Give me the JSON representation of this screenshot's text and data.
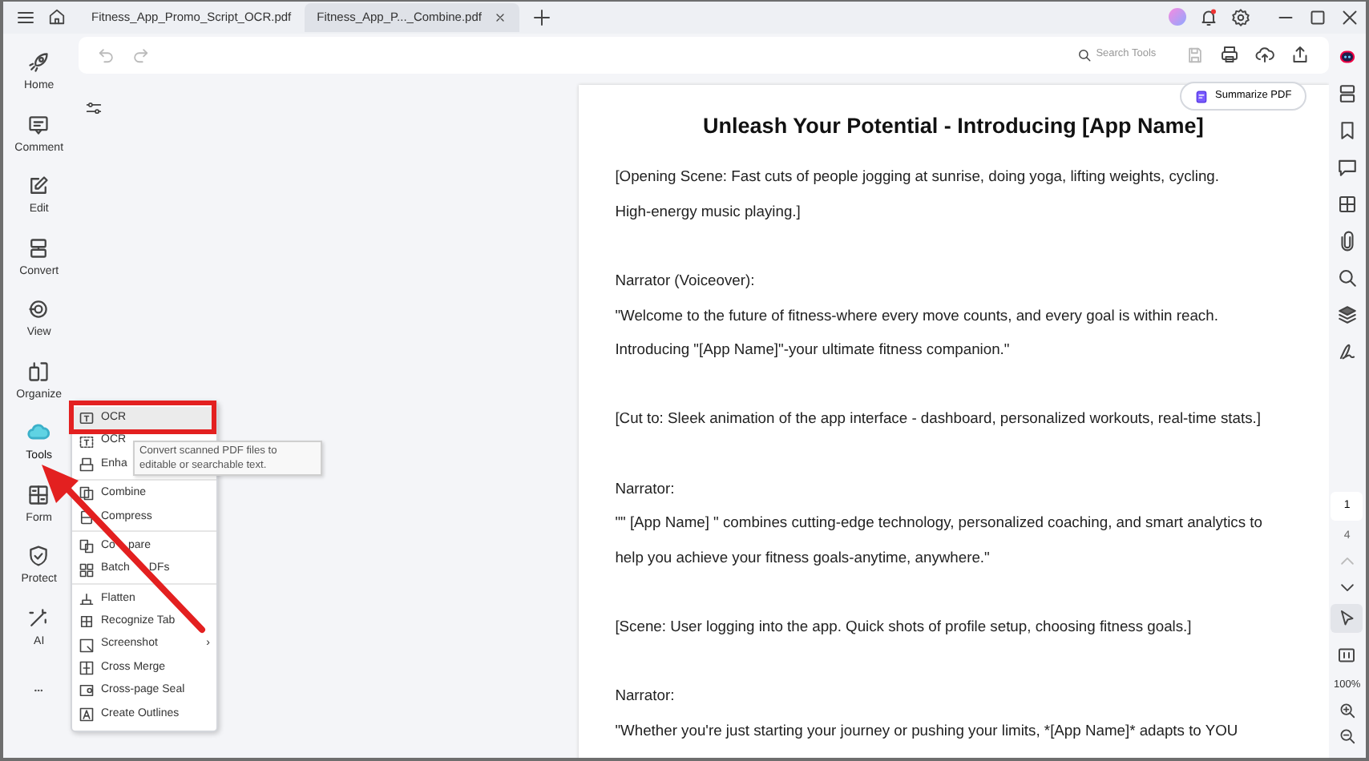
{
  "tabs": [
    {
      "label": "Fitness_App_Promo_Script_OCR.pdf",
      "selected": false,
      "closable": false
    },
    {
      "label": "Fitness_App_P..._Combine.pdf",
      "selected": true,
      "closable": true
    }
  ],
  "notifications": {
    "unread": true
  },
  "search": {
    "placeholder": "Search Tools"
  },
  "sidebar": {
    "items": [
      {
        "kind": "home",
        "label": "Home",
        "selected": false
      },
      {
        "kind": "comment",
        "label": "Comment",
        "selected": false
      },
      {
        "kind": "edit",
        "label": "Edit",
        "selected": false
      },
      {
        "kind": "convert",
        "label": "Convert",
        "selected": false
      },
      {
        "kind": "view",
        "label": "View",
        "selected": false
      },
      {
        "kind": "organize",
        "label": "Organize",
        "selected": false
      },
      {
        "kind": "tools",
        "label": "Tools",
        "selected": true
      },
      {
        "kind": "form",
        "label": "Form",
        "selected": false
      },
      {
        "kind": "protect",
        "label": "Protect",
        "selected": false
      },
      {
        "kind": "ai",
        "label": "AI",
        "selected": false
      }
    ]
  },
  "summarize_button": "Summarize PDF",
  "menu": {
    "groups": [
      [
        {
          "kind": "ocr",
          "label": "OCR",
          "selected": true,
          "submenu": false
        },
        {
          "kind": "ocr-area",
          "label": "OCR",
          "selected": false,
          "submenu": false
        },
        {
          "kind": "enhance",
          "label": "Enha",
          "selected": false,
          "submenu": false
        }
      ],
      [
        {
          "kind": "combine",
          "label": "Combine",
          "selected": false,
          "submenu": false
        },
        {
          "kind": "compress",
          "label": "Compress",
          "selected": false,
          "submenu": false
        }
      ],
      [
        {
          "kind": "compare",
          "label": [
            "Co",
            "pare"
          ],
          "selected": false,
          "submenu": false
        },
        {
          "kind": "batch",
          "label": [
            "Batch",
            "DFs"
          ],
          "selected": false,
          "submenu": false
        }
      ],
      [
        {
          "kind": "flatten",
          "label": "Flatten",
          "selected": false,
          "submenu": false
        },
        {
          "kind": "table",
          "label": "Recognize Tab",
          "selected": false,
          "submenu": false
        },
        {
          "kind": "screenshot",
          "label": "Screenshot",
          "selected": false,
          "submenu": true
        },
        {
          "kind": "merge",
          "label": "Cross Merge",
          "selected": false,
          "submenu": false
        },
        {
          "kind": "seal",
          "label": "Cross-page Seal",
          "selected": false,
          "submenu": false
        },
        {
          "kind": "outline",
          "label": "Create Outlines",
          "selected": false,
          "submenu": false
        }
      ]
    ],
    "submenu_mark": "›"
  },
  "tooltip": "Convert scanned PDF files to editable or searchable text.",
  "document": {
    "title": "Unleash Your Potential - Introducing [App Name]",
    "paragraphs": [
      [
        "[Opening Scene: Fast cuts of people jogging at sunrise, doing yoga, lifting weights, cycling.",
        "High-energy music playing.]"
      ],
      [
        "Narrator (Voiceover):",
        "\"Welcome to the future of fitness-where every move counts, and every goal is within reach.",
        "Introducing \"[App Name]\"-your ultimate fitness companion.\""
      ],
      [
        "[Cut to: Sleek animation of the app interface - dashboard, personalized workouts, real-time stats.]"
      ],
      [
        "Narrator:",
        "\"\" [App Name] \" combines cutting-edge technology, personalized coaching, and smart analytics to",
        "help you achieve your fitness goals-anytime, anywhere.\""
      ],
      [
        "[Scene: User logging into the app. Quick shots of profile setup, choosing fitness goals.]"
      ],
      [
        "Narrator:",
        "\"Whether you're just starting your journey or pushing your limits, *[App Name]* adapts to YOU"
      ]
    ]
  },
  "right_tools": [
    {
      "kind": "ai-assistant",
      "selected": false
    },
    {
      "kind": "thumbnails",
      "selected": false
    },
    {
      "kind": "bookmark",
      "selected": false
    },
    {
      "kind": "comment",
      "selected": false
    },
    {
      "kind": "fields",
      "selected": false
    },
    {
      "kind": "attachment",
      "selected": false
    },
    {
      "kind": "search",
      "selected": false
    },
    {
      "kind": "layers",
      "selected": false
    },
    {
      "kind": "signature",
      "selected": false
    }
  ],
  "page_nav": {
    "current": "1",
    "total": "4"
  },
  "view_tools": [
    {
      "kind": "select",
      "selected": true
    },
    {
      "kind": "fit",
      "selected": false
    }
  ],
  "zoom": "100%"
}
